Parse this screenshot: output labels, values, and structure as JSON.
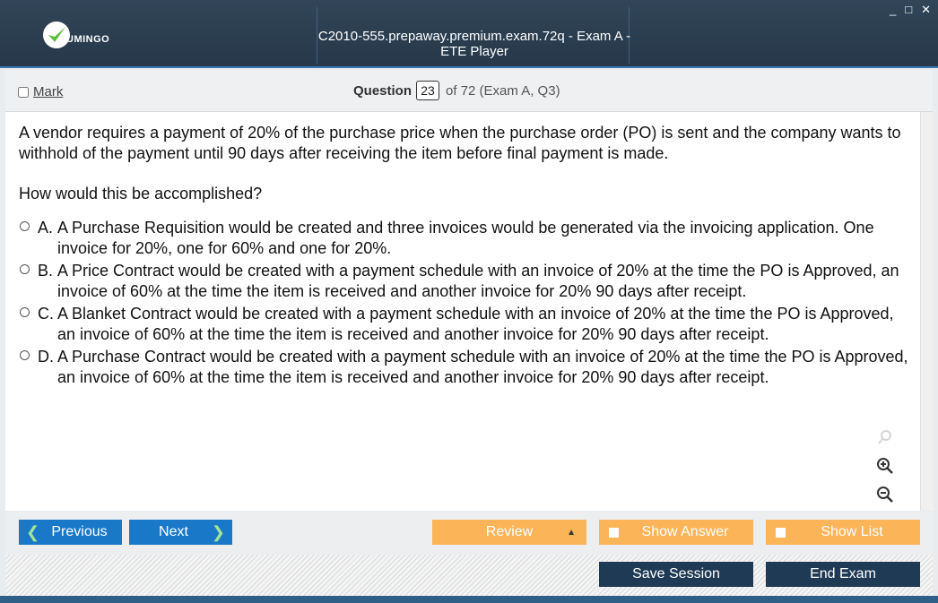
{
  "window": {
    "title": "C2010-555.prepaway.premium.exam.72q - Exam A - ETE Player",
    "controls": {
      "minimize": "_",
      "maximize": "□",
      "close": "✕"
    }
  },
  "logo": {
    "text": "UMINGO",
    "icon": "check-logo-icon",
    "colors": {
      "check": "#5dbb3f"
    }
  },
  "header": {
    "mark_label": "Mark",
    "question_label": "Question",
    "question_number": "23",
    "question_of": "of 72 (Exam A, Q3)"
  },
  "question": {
    "text": "A vendor requires a payment of 20% of the purchase price when the purchase order (PO) is sent and the company wants to withhold of the payment until 90 days after receiving the item before final payment is made.",
    "ask": "How would this be accomplished?",
    "options": [
      {
        "letter": "A.",
        "text": "A Purchase Requisition would be created and three invoices would be generated via the invoicing application. One invoice for 20%, one for 60% and one for 20%."
      },
      {
        "letter": "B.",
        "text": "A Price Contract would be created with a payment schedule with an invoice of 20% at the time the PO is Approved, an invoice of 60% at the time the item is received and another invoice for 20% 90 days after receipt."
      },
      {
        "letter": "C.",
        "text": "A Blanket Contract would be created with a payment schedule with an invoice of 20% at the time the PO is Approved, an invoice of 60% at the time the item is received and another invoice for 20% 90 days after receipt."
      },
      {
        "letter": "D.",
        "text": "A Purchase Contract would be created with a payment schedule with an invoice of 20% at the time the PO is Approved, an invoice of 60% at the time the item is received and another invoice for 20% 90 days after receipt."
      }
    ]
  },
  "toolbar": {
    "previous": "Previous",
    "next": "Next",
    "review": "Review",
    "show_answer": "Show Answer",
    "show_list": "Show List",
    "save_session": "Save Session",
    "end_exam": "End Exam"
  },
  "colors": {
    "title_bar": "#2b3f52",
    "nav_button": "#1a78c8",
    "action_button": "#fbb458",
    "session_button": "#1e3a54"
  }
}
